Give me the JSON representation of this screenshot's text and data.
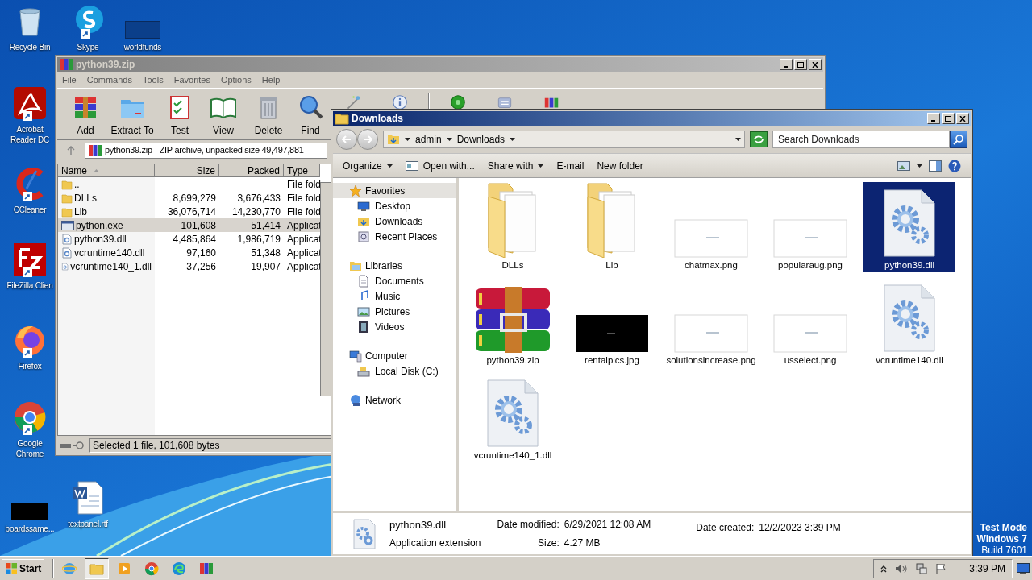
{
  "desktop_icons": [
    {
      "label": "Recycle Bin",
      "kind": "recycle"
    },
    {
      "label": "Skype",
      "kind": "skype"
    },
    {
      "label": "worldfunds",
      "kind": "blank"
    },
    {
      "label": "Acrobat Reader DC",
      "kind": "acrobat"
    },
    {
      "label": "CCleaner",
      "kind": "ccleaner"
    },
    {
      "label": "FileZilla Clien",
      "kind": "filezilla"
    },
    {
      "label": "Firefox",
      "kind": "firefox"
    },
    {
      "label": "Google Chrome",
      "kind": "chrome"
    },
    {
      "label": "boardssame...",
      "kind": "dark"
    },
    {
      "label": "textpanel.rtf",
      "kind": "word"
    }
  ],
  "archive_window": {
    "title": "python39.zip",
    "menu": [
      "File",
      "Commands",
      "Tools",
      "Favorites",
      "Options",
      "Help"
    ],
    "toolbar": [
      {
        "label": "Add",
        "kind": "add"
      },
      {
        "label": "Extract To",
        "kind": "extract"
      },
      {
        "label": "Test",
        "kind": "test"
      },
      {
        "label": "View",
        "kind": "view"
      },
      {
        "label": "Delete",
        "kind": "delete"
      },
      {
        "label": "Find",
        "kind": "find"
      },
      {
        "kind": "wizard"
      },
      {
        "kind": "info"
      },
      {
        "kind": "virus"
      },
      {
        "kind": "comment"
      },
      {
        "kind": "sfx"
      }
    ],
    "path": "python39.zip - ZIP archive, unpacked size 49,497,881",
    "columns": [
      "Name",
      "Size",
      "Packed",
      "Type"
    ],
    "rows": [
      {
        "name": "..",
        "kind": "folder",
        "type": "File fold",
        "selected": false
      },
      {
        "name": "DLLs",
        "kind": "folder",
        "size": "8,699,279",
        "packed": "3,676,433",
        "type": "File fold",
        "selected": false
      },
      {
        "name": "Lib",
        "kind": "folder",
        "size": "36,076,714",
        "packed": "14,230,770",
        "type": "File fold",
        "selected": false
      },
      {
        "name": "python.exe",
        "kind": "exe",
        "size": "101,608",
        "packed": "51,414",
        "type": "Applicat",
        "selected": true
      },
      {
        "name": "python39.dll",
        "kind": "dll",
        "size": "4,485,864",
        "packed": "1,986,719",
        "type": "Applicat",
        "selected": false
      },
      {
        "name": "vcruntime140.dll",
        "kind": "dll",
        "size": "97,160",
        "packed": "51,348",
        "type": "Applicat",
        "selected": false
      },
      {
        "name": "vcruntime140_1.dll",
        "kind": "dll",
        "size": "37,256",
        "packed": "19,907",
        "type": "Applicat",
        "selected": false
      }
    ],
    "status": "Selected 1 file, 101,608 bytes"
  },
  "explorer": {
    "title": "Downloads",
    "breadcrumb": [
      "admin",
      "Downloads"
    ],
    "search": {
      "placeholder": "Search Downloads"
    },
    "commands": [
      {
        "label": "Organize",
        "kind": "menu"
      },
      {
        "label": "Open with...",
        "kind": "openwith"
      },
      {
        "label": "Share with",
        "kind": "menu"
      },
      {
        "label": "E-mail",
        "kind": "plain"
      },
      {
        "label": "New folder",
        "kind": "plain"
      }
    ],
    "nav": [
      {
        "label": "Favorites",
        "kind": "star",
        "selected": true,
        "children": [
          {
            "label": "Desktop",
            "kind": "desktop",
            "selected": false
          },
          {
            "label": "Downloads",
            "kind": "downloads",
            "selected": false
          },
          {
            "label": "Recent Places",
            "kind": "recent",
            "selected": false
          }
        ]
      },
      {
        "label": "Libraries",
        "kind": "libraries",
        "selected": false,
        "children": [
          {
            "label": "Documents",
            "kind": "documents",
            "selected": false
          },
          {
            "label": "Music",
            "kind": "music",
            "selected": false
          },
          {
            "label": "Pictures",
            "kind": "pictures",
            "selected": false
          },
          {
            "label": "Videos",
            "kind": "videos",
            "selected": false
          }
        ]
      },
      {
        "label": "Computer",
        "kind": "computer",
        "selected": false,
        "children": [
          {
            "label": "Local Disk (C:)",
            "kind": "disk",
            "selected": false
          }
        ]
      },
      {
        "label": "Network",
        "kind": "network",
        "selected": false
      }
    ],
    "files": [
      {
        "name": "DLLs",
        "kind": "folder",
        "selected": false
      },
      {
        "name": "Lib",
        "kind": "folder",
        "selected": false
      },
      {
        "name": "chatmax.png",
        "selected": false
      },
      {
        "name": "popularaug.png",
        "selected": false
      },
      {
        "name": "python39.dll",
        "kind": "dll",
        "selected": true
      },
      {
        "name": "python39.zip",
        "kind": "zip",
        "selected": false
      },
      {
        "name": "rentalpics.jpg",
        "kind": "image-dark",
        "selected": false
      },
      {
        "name": "solutionsincrease.png",
        "selected": false
      },
      {
        "name": "usselect.png",
        "selected": false
      },
      {
        "name": "vcruntime140.dll",
        "kind": "dll",
        "selected": false
      },
      {
        "name": "vcruntime140_1.dll",
        "kind": "dll",
        "selected": false
      }
    ],
    "details": {
      "name": "python39.dll",
      "type": "Application extension",
      "modified_label": "Date modified:",
      "modified": "6/29/2021 12:08 AM",
      "size_label": "Size:",
      "size": "4.27 MB",
      "created_label": "Date created:",
      "created": "12/2/2023 3:39 PM"
    }
  },
  "test_mode": [
    "Test Mode",
    "Windows 7",
    "Build 7601"
  ],
  "taskbar": {
    "start": "Start",
    "apps": [
      {
        "kind": "ie",
        "active": false
      },
      {
        "kind": "explorer",
        "active": true
      },
      {
        "kind": "media",
        "active": false
      },
      {
        "kind": "chrome",
        "active": false
      },
      {
        "kind": "edge",
        "active": false
      },
      {
        "kind": "winrar",
        "active": false
      }
    ],
    "time": "3:39 PM"
  }
}
